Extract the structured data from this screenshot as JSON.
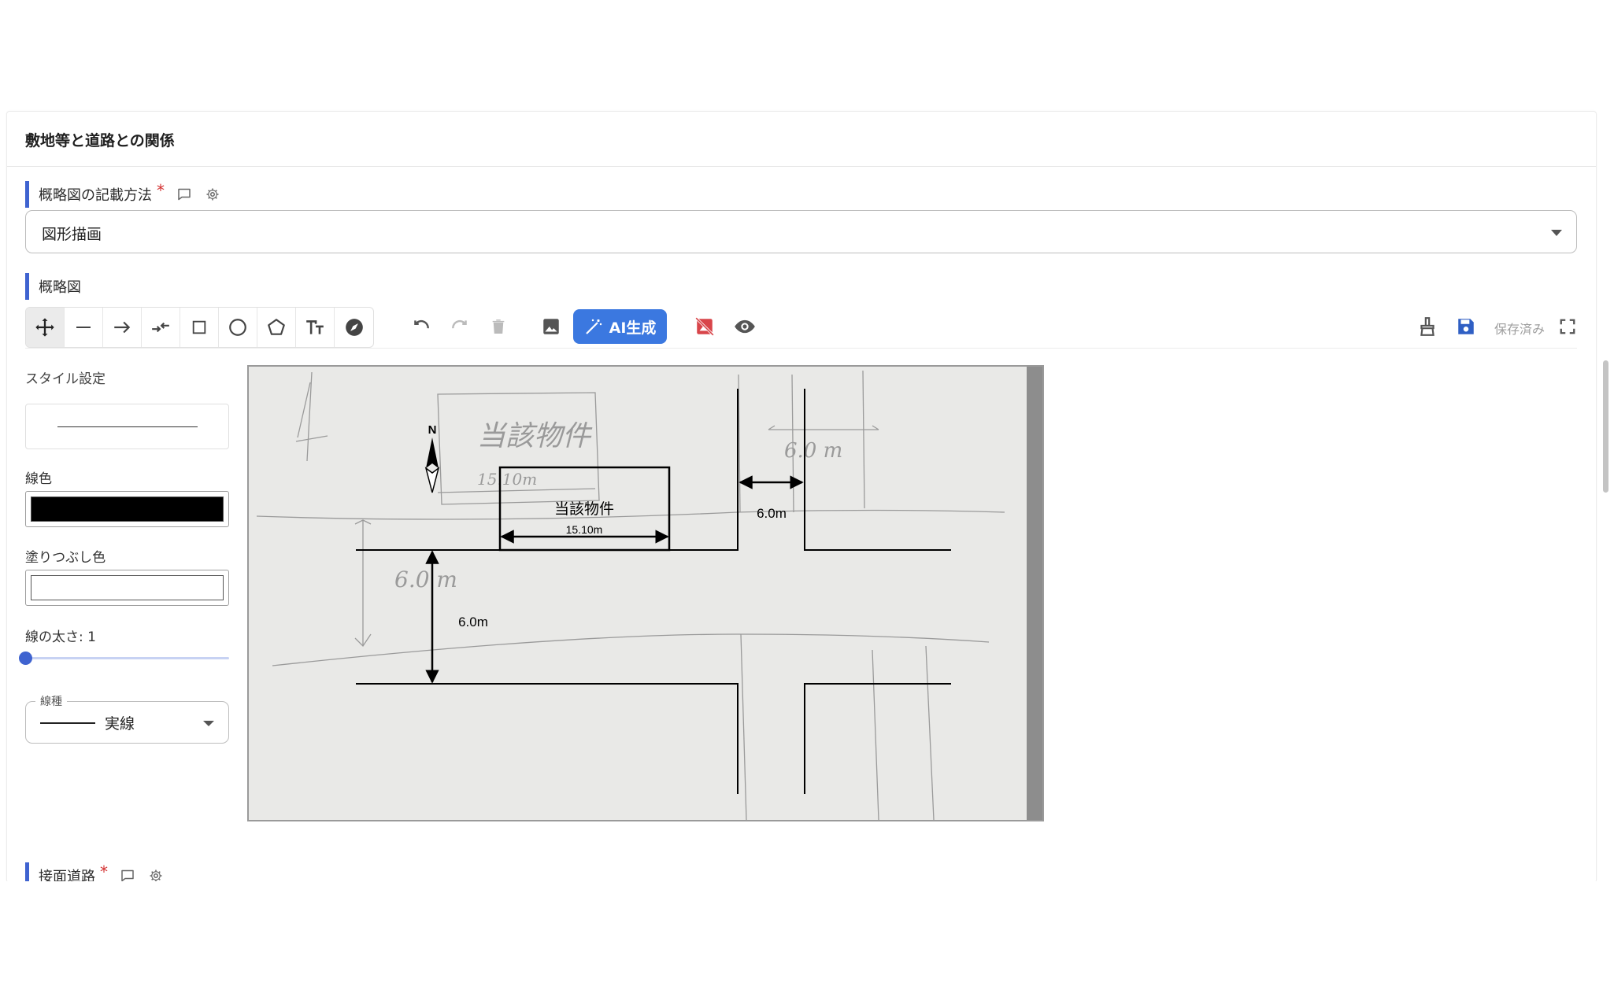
{
  "card": {
    "title": "敷地等と道路との関係"
  },
  "method_field": {
    "label": "概略図の記載方法",
    "required_mark": "*",
    "selected_value": "図形描画"
  },
  "sketch_field": {
    "label": "概略図"
  },
  "toolbar": {
    "tools": [
      "move-icon",
      "line-icon",
      "arrow-icon",
      "dimension-icon",
      "rectangle-icon",
      "circle-icon",
      "polygon-icon",
      "text-icon",
      "compass-icon"
    ],
    "active_tool": "move-icon",
    "ai_label": "AI生成",
    "save_status": "保存済み",
    "accent_color": "#3b78e0"
  },
  "style_panel": {
    "title": "スタイル設定",
    "line_color_label": "線色",
    "line_color": "#000000",
    "fill_color_label": "塗りつぶし色",
    "fill_color": "#ffffff",
    "line_width_label": "線の太さ: 1",
    "line_width": 1,
    "line_type_legend": "線種",
    "line_type_value": "実線"
  },
  "drawing": {
    "north_label": "N",
    "property_label": "当該物件",
    "frontage_dimension": "15.10m",
    "side_road_width": "6.0m",
    "main_road_width": "6.0m",
    "handwritten_property": "当該物件",
    "handwritten_frontage": "15.10m",
    "handwritten_side_road": "6.0 m",
    "handwritten_main_road": "6.0 m"
  },
  "next_field": {
    "label": "接面道路",
    "required_mark": "*"
  }
}
